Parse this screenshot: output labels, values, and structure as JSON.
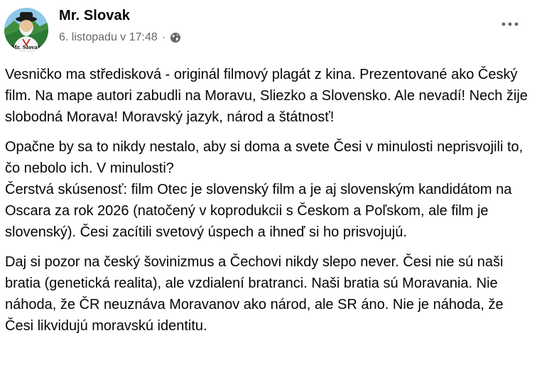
{
  "post": {
    "author": "Mr. Slovak",
    "avatar_caption": "Mr. Slovak",
    "timestamp": "6. listopadu v 17:48",
    "separator": "·",
    "audience_icon": "globe-icon",
    "more_icon": "more-options-icon",
    "paragraphs": [
      "Vesničko ma středisková - originál filmový plagát z kina. Prezentované ako Český film. Na mape autori zabudli na Moravu, Sliezko a Slovensko. Ale nevadí! Nech žije slobodná Morava! Moravský jazyk, národ a štátnosť!",
      "Opačne by sa to nikdy nestalo, aby si doma a svete Česi v minulosti neprisvojili to, čo nebolo ich. V minulosti?",
      "Čerstvá skúsenosť: film Otec je slovenský film a je aj slovenským kandidátom na Oscara za rok 2026 (natočený v koprodukcii s Českom a Poľskom, ale film je slovenský). Česi zacítili svetový úspech a ihneď si ho prisvojujú.",
      "Daj si pozor na český šovinizmus a Čechovi nikdy slepo never. Česi nie sú naši bratia (genetická realita), ale vzdialení bratranci. Naši bratia sú Moravania. Nie náhoda, že ČR neuznáva Moravanov ako národ, ale SR áno. Nie je náhoda, že Česi likvidujú moravskú identitu."
    ]
  },
  "colors": {
    "text": "#050505",
    "secondary_text": "#65676b",
    "avatar_bg": "#2f9e4a"
  }
}
